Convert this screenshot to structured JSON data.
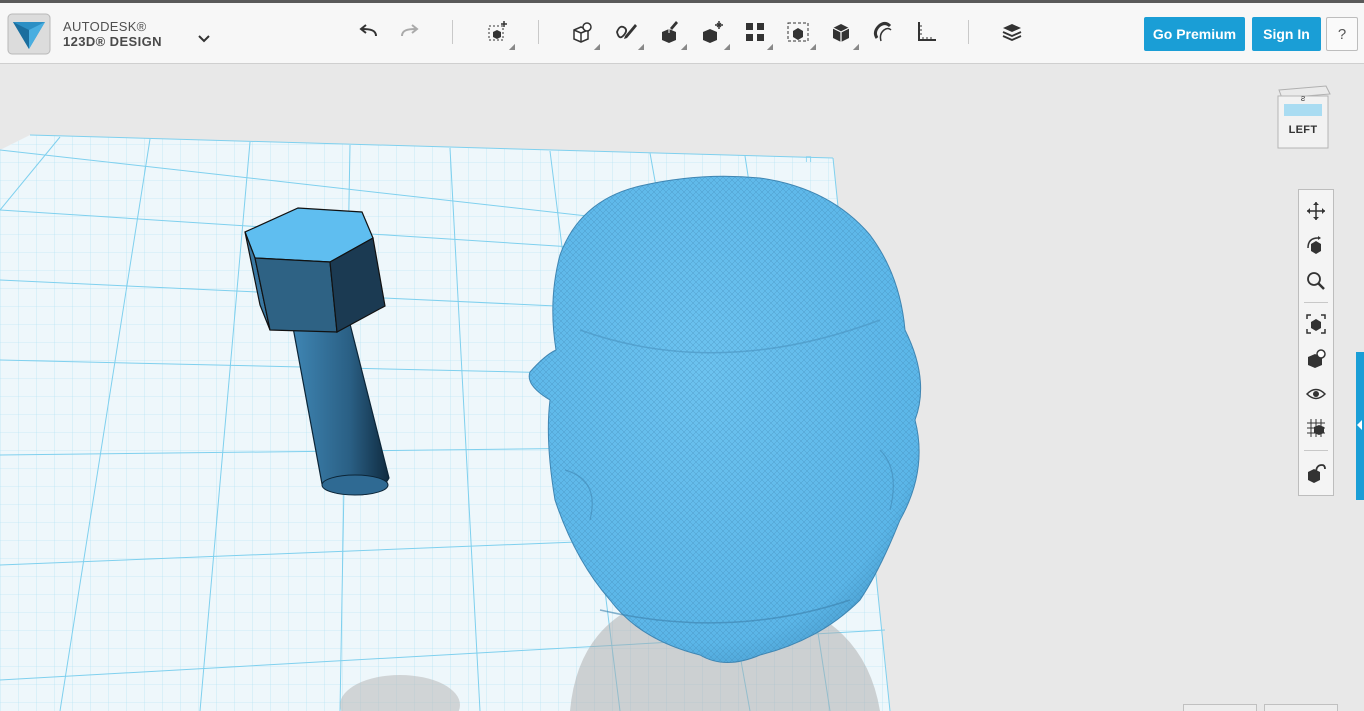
{
  "app": {
    "brand_line1": "AUTODESK®",
    "brand_line2": "123D® DESIGN"
  },
  "toolbar": {
    "undo_icon": "undo-icon",
    "redo_icon": "redo-icon",
    "tools": [
      "transform",
      "primitives",
      "sketch",
      "construct",
      "modify",
      "pattern",
      "grouping",
      "combine",
      "measure",
      "snap",
      "ruler",
      "material"
    ]
  },
  "header_buttons": {
    "premium_label": "Go Premium",
    "signin_label": "Sign In",
    "help_label": "?"
  },
  "viewcube": {
    "face_label": "LEFT"
  },
  "colors": {
    "accent": "#1a9ed6",
    "model": "#5bb8ec",
    "grid": "#7fd0ee"
  }
}
